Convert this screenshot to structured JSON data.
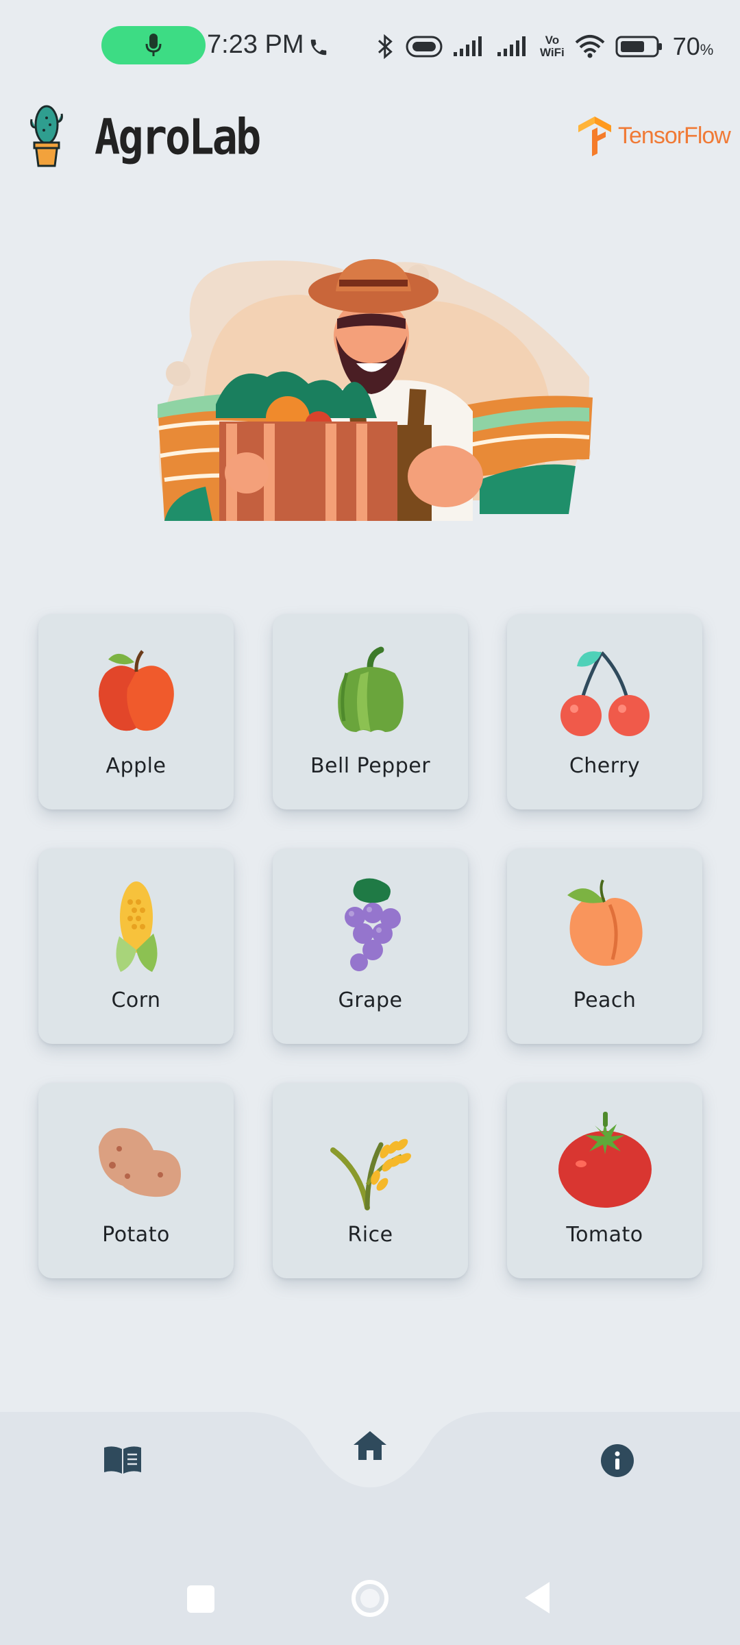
{
  "status_bar": {
    "time": "7:23 PM",
    "vowifi_top": "Vo",
    "vowifi_bottom": "WiFi",
    "battery_percent": "70",
    "battery_unit": "%"
  },
  "header": {
    "app_name": "AgroLab",
    "partner_logo_text": "TensorFlow"
  },
  "crops": [
    {
      "label": "Apple",
      "icon": "apple-icon"
    },
    {
      "label": "Bell Pepper",
      "icon": "bell-pepper-icon"
    },
    {
      "label": "Cherry",
      "icon": "cherry-icon"
    },
    {
      "label": "Corn",
      "icon": "corn-icon"
    },
    {
      "label": "Grape",
      "icon": "grape-icon"
    },
    {
      "label": "Peach",
      "icon": "peach-icon"
    },
    {
      "label": "Potato",
      "icon": "potato-icon"
    },
    {
      "label": "Rice",
      "icon": "rice-icon"
    },
    {
      "label": "Tomato",
      "icon": "tomato-icon"
    }
  ],
  "bottom_nav": {
    "items": [
      "book-icon",
      "home-icon",
      "info-icon"
    ]
  },
  "colors": {
    "background": "#e8ecf0",
    "card": "#dde4e8",
    "nav_icon": "#2f4a5c",
    "mic_pill": "#3ddc84",
    "tensorflow_orange": "#f07a36"
  }
}
